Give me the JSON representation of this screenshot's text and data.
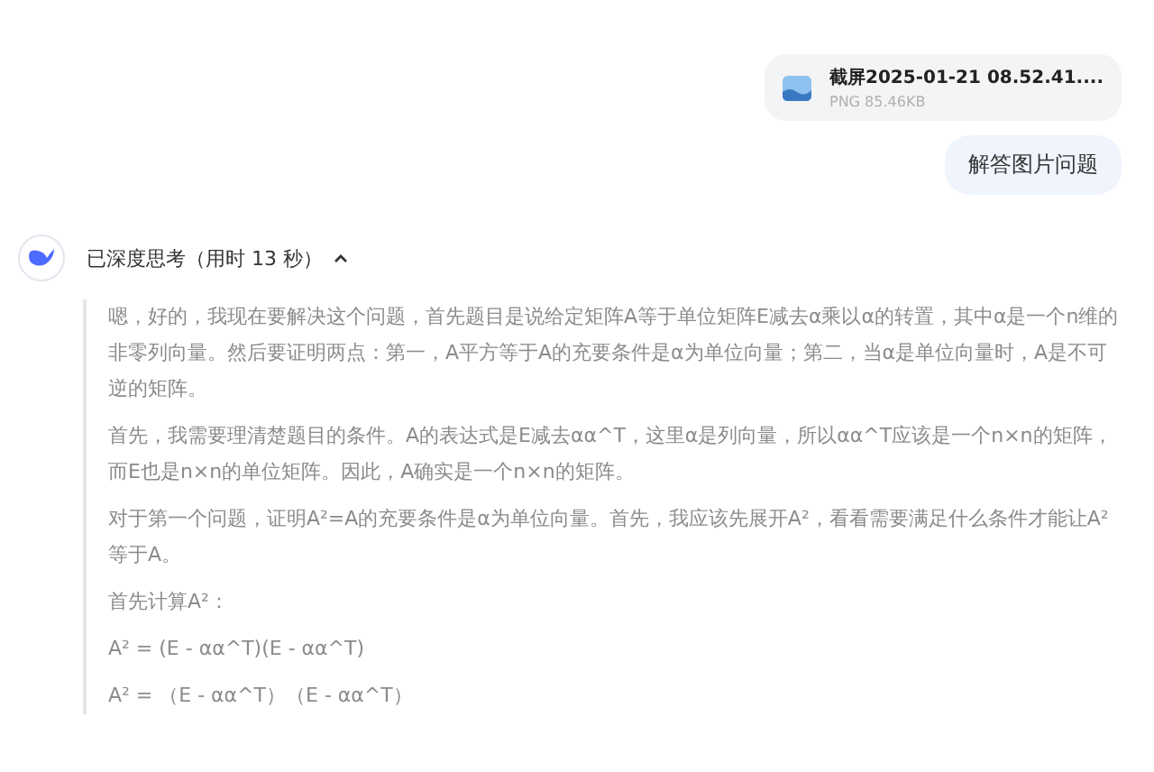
{
  "attachment": {
    "name": "截屏2025-01-21 08.52.41....",
    "meta": "PNG 85.46KB"
  },
  "user_message": "解答图片问题",
  "thinking": {
    "label": "已深度思考（用时 13 秒）",
    "expanded": true,
    "paragraphs": [
      "嗯，好的，我现在要解决这个问题，首先题目是说给定矩阵A等于单位矩阵E减去α乘以α的转置，其中α是一个n维的非零列向量。然后要证明两点：第一，A平方等于A的充要条件是α为单位向量；第二，当α是单位向量时，A是不可逆的矩阵。",
      "首先，我需要理清楚题目的条件。A的表达式是E减去αα^T，这里α是列向量，所以αα^T应该是一个n×n的矩阵，而E也是n×n的单位矩阵。因此，A确实是一个n×n的矩阵。",
      "对于第一个问题，证明A²=A的充要条件是α为单位向量。首先，我应该先展开A²，看看需要满足什么条件才能让A²等于A。",
      "首先计算A²：",
      "A² = (E - αα^T)(E - αα^T)",
      "A² = （E - αα^T）（E - αα^T）"
    ]
  }
}
